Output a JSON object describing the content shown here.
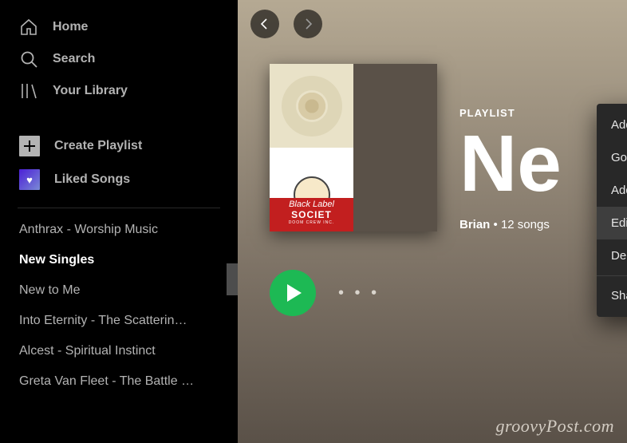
{
  "sidebar": {
    "nav": {
      "home": "Home",
      "search": "Search",
      "library": "Your Library",
      "create": "Create Playlist",
      "liked": "Liked Songs"
    },
    "playlists": [
      "Anthrax - Worship Music",
      "New Singles",
      "New to Me",
      "Into Eternity - The Scatterin…",
      "Alcest - Spiritual Instinct",
      "Greta Van Fleet - The Battle …"
    ],
    "selected_index": 1
  },
  "main": {
    "tag": "PLAYLIST",
    "title": "Ne",
    "byline_author": "Brian",
    "byline_sep": " • ",
    "byline_count": "12 songs"
  },
  "cover": {
    "band_line1": "Black Label",
    "band_line2": "SOCIET",
    "band_line3": "DOOM CREW INC."
  },
  "context_menu": {
    "items": [
      {
        "label": "Add to queue",
        "submenu": false
      },
      {
        "label": "Go to playlist radio",
        "submenu": false
      },
      {
        "label": "Add to profile",
        "submenu": false
      },
      {
        "label": "Edit details",
        "submenu": false,
        "highlight": true
      },
      {
        "label": "Delete",
        "submenu": false
      },
      {
        "label": "Share",
        "submenu": true,
        "divider_before": true
      }
    ]
  },
  "watermark": "groovyPost.com"
}
